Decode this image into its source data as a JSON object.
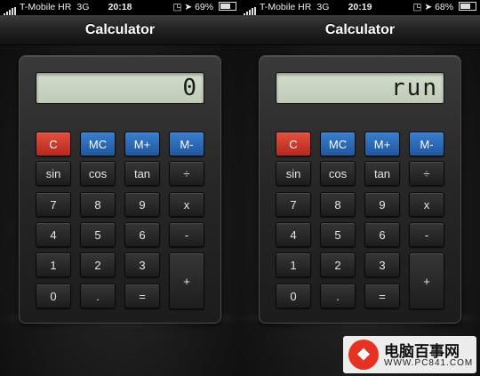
{
  "screens": [
    {
      "status": {
        "carrier": "T-Mobile HR",
        "network": "3G",
        "time": "20:18",
        "battery": "69%",
        "battery_level": 0.69
      },
      "title": "Calculator",
      "display": "0"
    },
    {
      "status": {
        "carrier": "T-Mobile HR",
        "network": "3G",
        "time": "20:19",
        "battery": "68%",
        "battery_level": 0.68
      },
      "title": "Calculator",
      "display": "run"
    }
  ],
  "keys": {
    "clear": "C",
    "mc": "MC",
    "mplus": "M+",
    "mminus": "M-",
    "sin": "sin",
    "cos": "cos",
    "tan": "tan",
    "divide": "÷",
    "seven": "7",
    "eight": "8",
    "nine": "9",
    "multiply": "x",
    "four": "4",
    "five": "5",
    "six": "6",
    "subtract": "-",
    "one": "1",
    "two": "2",
    "three": "3",
    "add": "+",
    "zero": "0",
    "decimal": ".",
    "equals": "="
  },
  "colors": {
    "clear_key": "#c93a2a",
    "memory_keys": "#2b6bb8",
    "display": "#c7d2c0"
  },
  "icons": [
    "signal-bars-icon",
    "lock-icon",
    "location-arrow-icon",
    "battery-icon"
  ],
  "watermark": {
    "text": "电脑百事网",
    "url": "WWW.PC841.COM"
  }
}
